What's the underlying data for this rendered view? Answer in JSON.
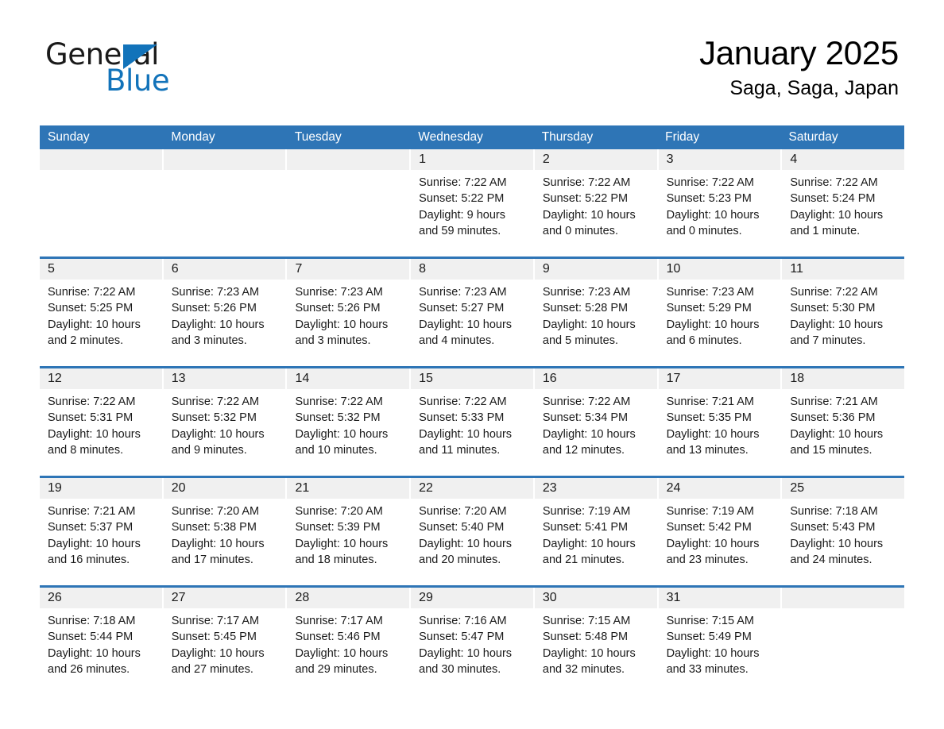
{
  "brand": {
    "name_part1": "General",
    "name_part2": "Blue",
    "triangle_icon": "triangle-icon",
    "accent_color": "#1273ba"
  },
  "header": {
    "title": "January 2025",
    "subtitle": "Saga, Saga, Japan",
    "header_bg_color": "#2e75b6",
    "day_band_color": "#f0f0f0"
  },
  "weekdays": [
    "Sunday",
    "Monday",
    "Tuesday",
    "Wednesday",
    "Thursday",
    "Friday",
    "Saturday"
  ],
  "weeks": [
    [
      {
        "day": "",
        "info": ""
      },
      {
        "day": "",
        "info": ""
      },
      {
        "day": "",
        "info": ""
      },
      {
        "day": "1",
        "info": "Sunrise: 7:22 AM\nSunset: 5:22 PM\nDaylight: 9 hours\nand 59 minutes."
      },
      {
        "day": "2",
        "info": "Sunrise: 7:22 AM\nSunset: 5:22 PM\nDaylight: 10 hours\nand 0 minutes."
      },
      {
        "day": "3",
        "info": "Sunrise: 7:22 AM\nSunset: 5:23 PM\nDaylight: 10 hours\nand 0 minutes."
      },
      {
        "day": "4",
        "info": "Sunrise: 7:22 AM\nSunset: 5:24 PM\nDaylight: 10 hours\nand 1 minute."
      }
    ],
    [
      {
        "day": "5",
        "info": "Sunrise: 7:22 AM\nSunset: 5:25 PM\nDaylight: 10 hours\nand 2 minutes."
      },
      {
        "day": "6",
        "info": "Sunrise: 7:23 AM\nSunset: 5:26 PM\nDaylight: 10 hours\nand 3 minutes."
      },
      {
        "day": "7",
        "info": "Sunrise: 7:23 AM\nSunset: 5:26 PM\nDaylight: 10 hours\nand 3 minutes."
      },
      {
        "day": "8",
        "info": "Sunrise: 7:23 AM\nSunset: 5:27 PM\nDaylight: 10 hours\nand 4 minutes."
      },
      {
        "day": "9",
        "info": "Sunrise: 7:23 AM\nSunset: 5:28 PM\nDaylight: 10 hours\nand 5 minutes."
      },
      {
        "day": "10",
        "info": "Sunrise: 7:23 AM\nSunset: 5:29 PM\nDaylight: 10 hours\nand 6 minutes."
      },
      {
        "day": "11",
        "info": "Sunrise: 7:22 AM\nSunset: 5:30 PM\nDaylight: 10 hours\nand 7 minutes."
      }
    ],
    [
      {
        "day": "12",
        "info": "Sunrise: 7:22 AM\nSunset: 5:31 PM\nDaylight: 10 hours\nand 8 minutes."
      },
      {
        "day": "13",
        "info": "Sunrise: 7:22 AM\nSunset: 5:32 PM\nDaylight: 10 hours\nand 9 minutes."
      },
      {
        "day": "14",
        "info": "Sunrise: 7:22 AM\nSunset: 5:32 PM\nDaylight: 10 hours\nand 10 minutes."
      },
      {
        "day": "15",
        "info": "Sunrise: 7:22 AM\nSunset: 5:33 PM\nDaylight: 10 hours\nand 11 minutes."
      },
      {
        "day": "16",
        "info": "Sunrise: 7:22 AM\nSunset: 5:34 PM\nDaylight: 10 hours\nand 12 minutes."
      },
      {
        "day": "17",
        "info": "Sunrise: 7:21 AM\nSunset: 5:35 PM\nDaylight: 10 hours\nand 13 minutes."
      },
      {
        "day": "18",
        "info": "Sunrise: 7:21 AM\nSunset: 5:36 PM\nDaylight: 10 hours\nand 15 minutes."
      }
    ],
    [
      {
        "day": "19",
        "info": "Sunrise: 7:21 AM\nSunset: 5:37 PM\nDaylight: 10 hours\nand 16 minutes."
      },
      {
        "day": "20",
        "info": "Sunrise: 7:20 AM\nSunset: 5:38 PM\nDaylight: 10 hours\nand 17 minutes."
      },
      {
        "day": "21",
        "info": "Sunrise: 7:20 AM\nSunset: 5:39 PM\nDaylight: 10 hours\nand 18 minutes."
      },
      {
        "day": "22",
        "info": "Sunrise: 7:20 AM\nSunset: 5:40 PM\nDaylight: 10 hours\nand 20 minutes."
      },
      {
        "day": "23",
        "info": "Sunrise: 7:19 AM\nSunset: 5:41 PM\nDaylight: 10 hours\nand 21 minutes."
      },
      {
        "day": "24",
        "info": "Sunrise: 7:19 AM\nSunset: 5:42 PM\nDaylight: 10 hours\nand 23 minutes."
      },
      {
        "day": "25",
        "info": "Sunrise: 7:18 AM\nSunset: 5:43 PM\nDaylight: 10 hours\nand 24 minutes."
      }
    ],
    [
      {
        "day": "26",
        "info": "Sunrise: 7:18 AM\nSunset: 5:44 PM\nDaylight: 10 hours\nand 26 minutes."
      },
      {
        "day": "27",
        "info": "Sunrise: 7:17 AM\nSunset: 5:45 PM\nDaylight: 10 hours\nand 27 minutes."
      },
      {
        "day": "28",
        "info": "Sunrise: 7:17 AM\nSunset: 5:46 PM\nDaylight: 10 hours\nand 29 minutes."
      },
      {
        "day": "29",
        "info": "Sunrise: 7:16 AM\nSunset: 5:47 PM\nDaylight: 10 hours\nand 30 minutes."
      },
      {
        "day": "30",
        "info": "Sunrise: 7:15 AM\nSunset: 5:48 PM\nDaylight: 10 hours\nand 32 minutes."
      },
      {
        "day": "31",
        "info": "Sunrise: 7:15 AM\nSunset: 5:49 PM\nDaylight: 10 hours\nand 33 minutes."
      },
      {
        "day": "",
        "info": ""
      }
    ]
  ]
}
